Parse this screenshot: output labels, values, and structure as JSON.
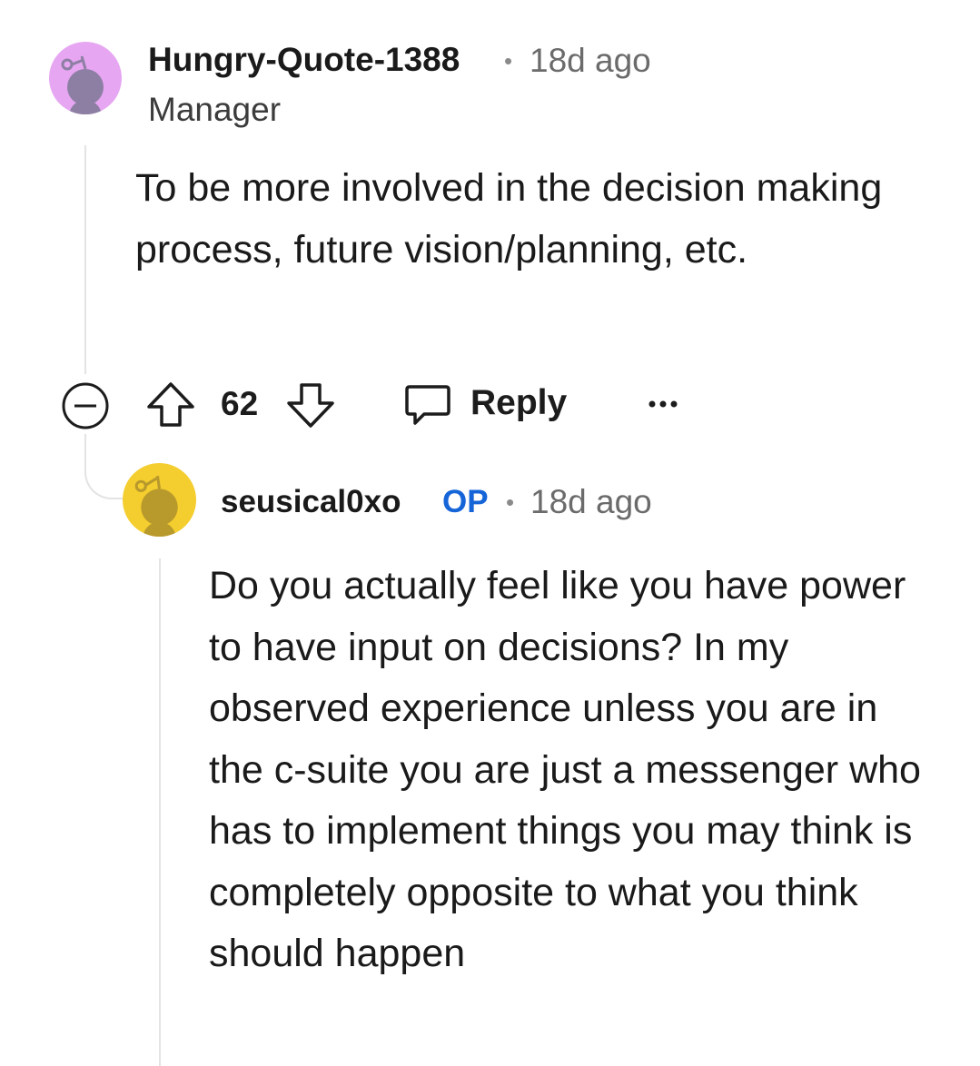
{
  "comments": [
    {
      "username": "Hungry-Quote-1388",
      "time": "18d ago",
      "flair": "Manager",
      "avatar_color": "#E6A6F2",
      "avatar_fg": "#8D7FA3",
      "body": "To be more involved in the decision making process, future vision/planning, etc.",
      "actions": {
        "collapse_icon": "collapse-minus-icon",
        "upvote_icon": "upvote-arrow-icon",
        "vote_count": "62",
        "downvote_icon": "downvote-arrow-icon",
        "reply_icon": "speech-bubble-icon",
        "reply_label": "Reply",
        "more_icon": "ellipsis-icon"
      }
    },
    {
      "username": "seusical0xo",
      "op_badge": "OP",
      "time": "18d ago",
      "avatar_color": "#F4CD2E",
      "avatar_fg": "#B8992C",
      "body": "Do you actually feel like you have power to have input on decisions? In my observed experience unless you are in the c-suite you are just a messenger who has to implement things you may think is completely opposite to what you think should happen"
    }
  ],
  "colors": {
    "op_blue": "#1565D8",
    "meta_gray": "#6B6B6B",
    "thread_line": "#E3E3E3"
  }
}
